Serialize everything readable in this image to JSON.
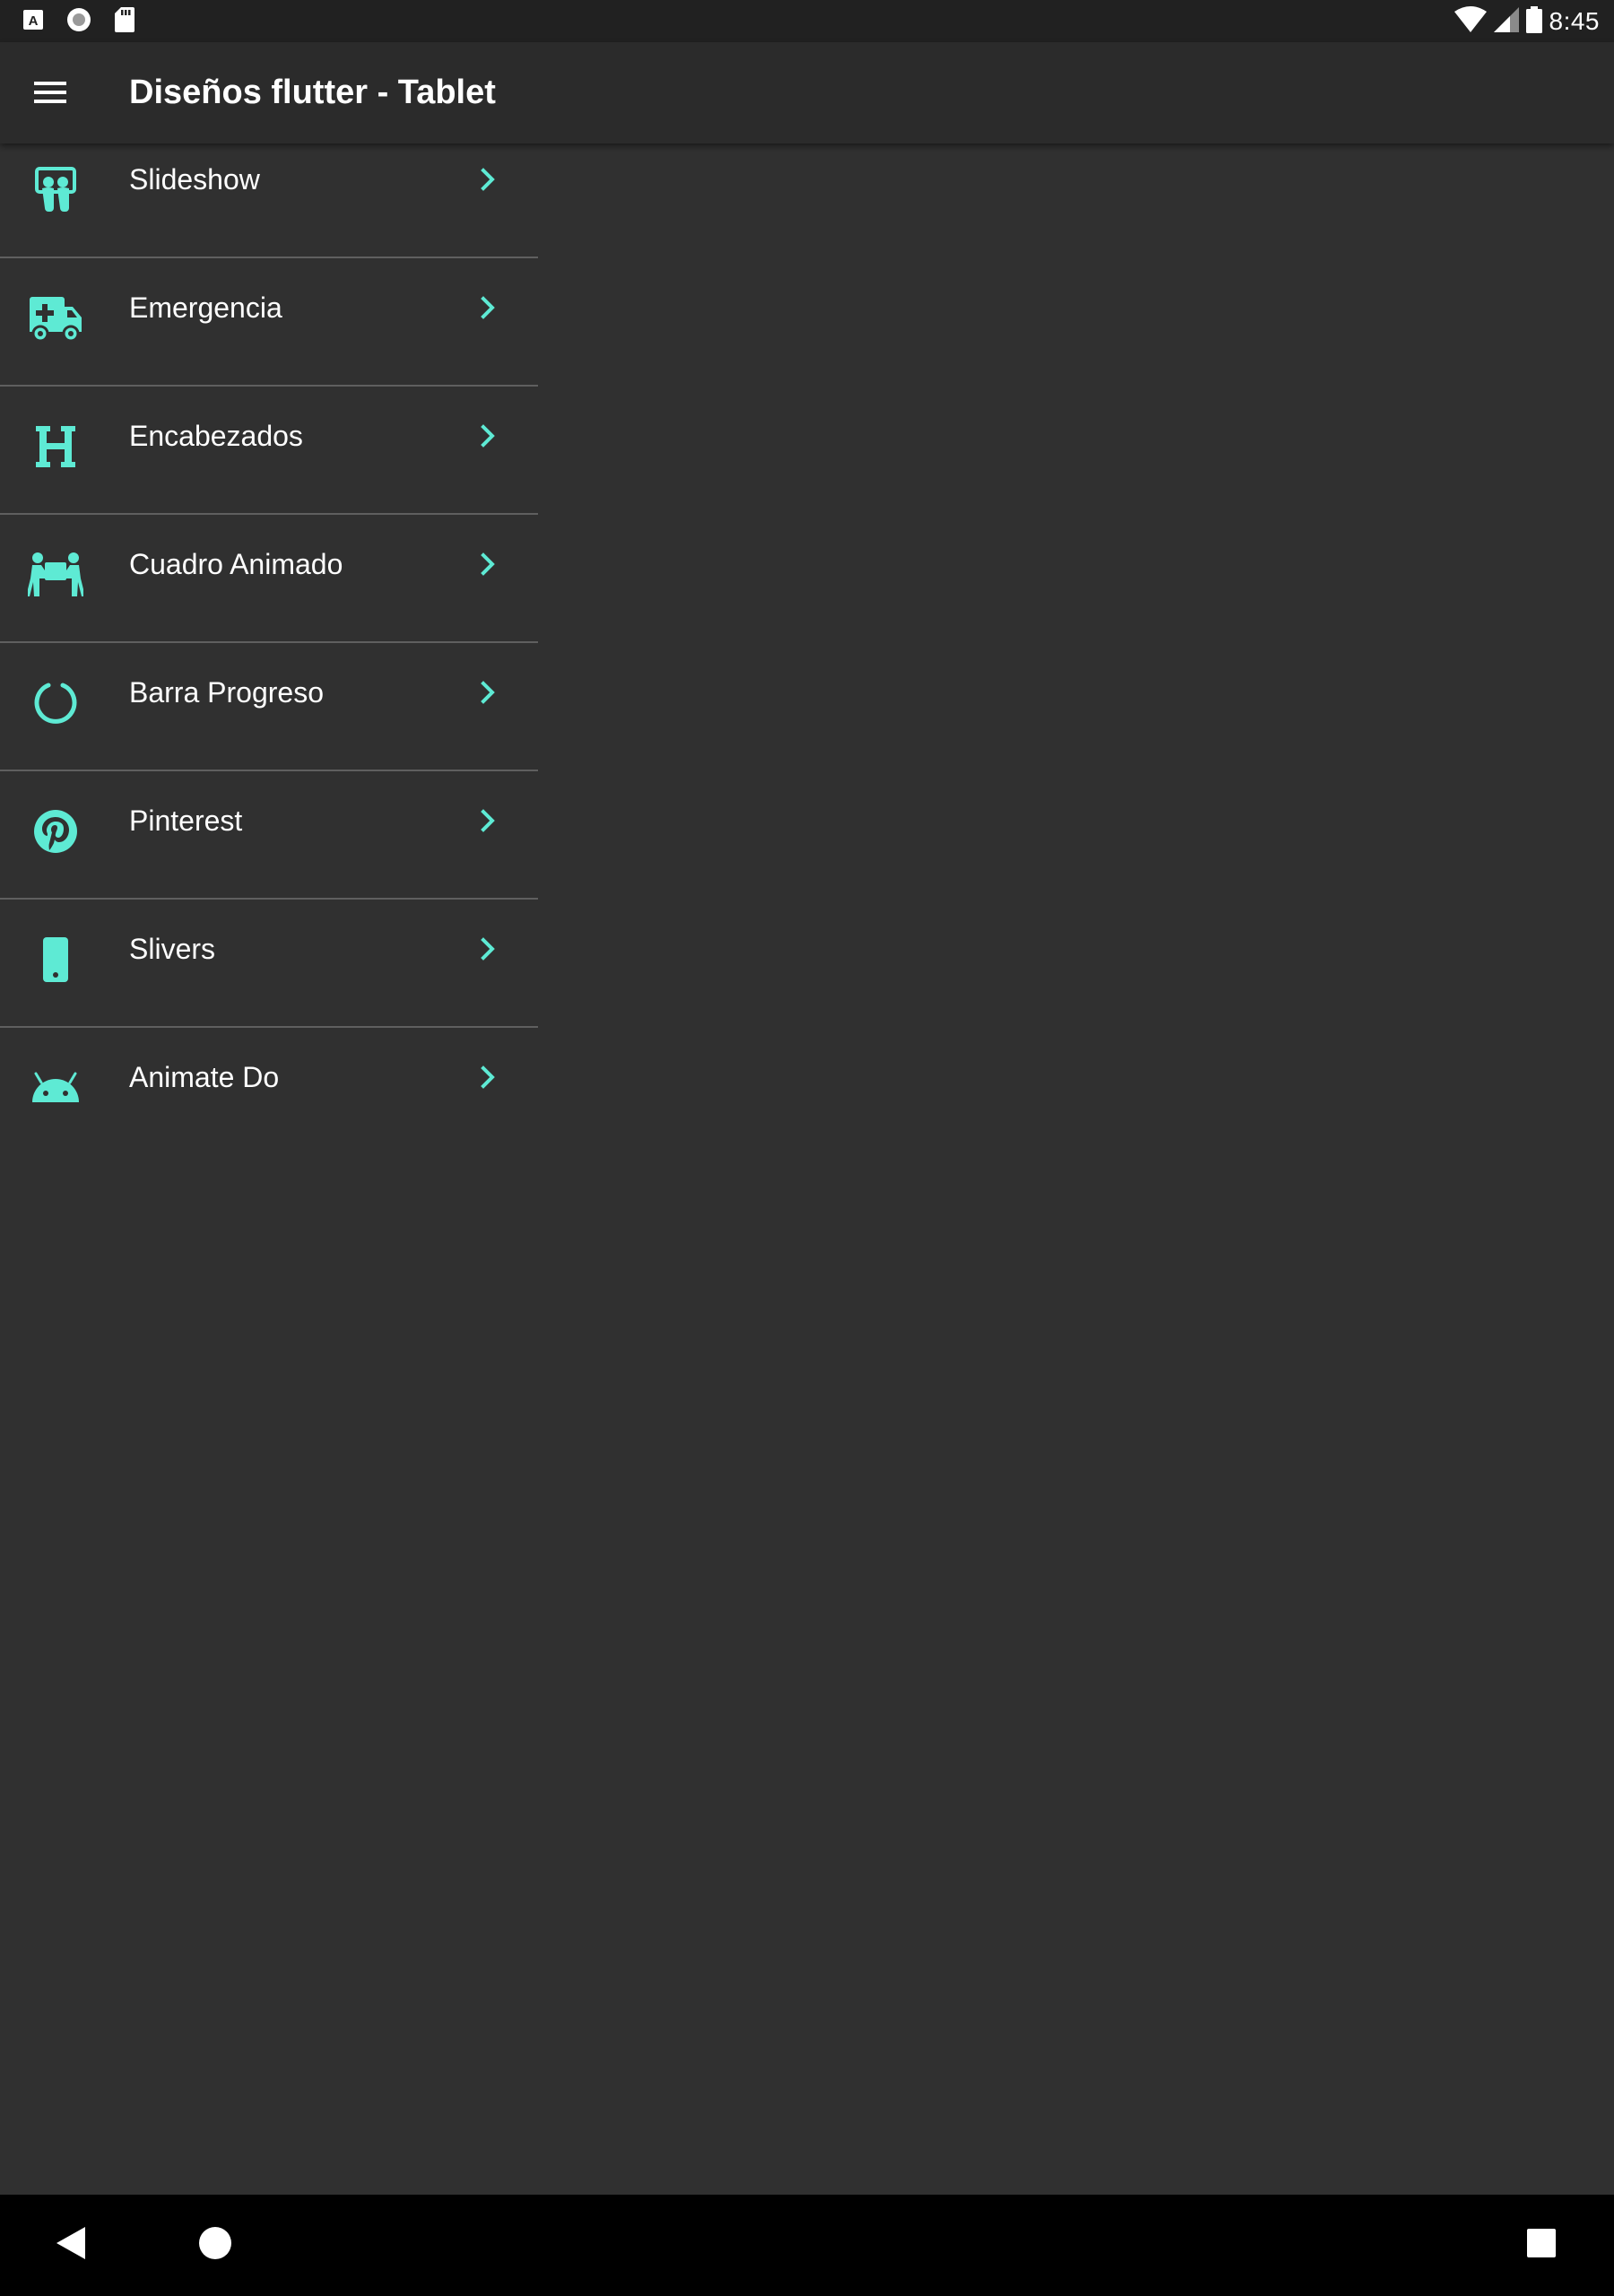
{
  "status_bar": {
    "time": "8:45",
    "left_icons": [
      "a-badge-icon",
      "record-icon",
      "sd-card-icon"
    ],
    "right_icons": [
      "wifi-icon",
      "cell-signal-icon",
      "battery-icon"
    ]
  },
  "app_bar": {
    "title": "Diseños flutter - Tablet",
    "menu_icon": "hamburger-menu-icon"
  },
  "colors": {
    "accent": "#5EEAD4",
    "background": "#303030",
    "app_bar": "#2b2b2b",
    "status_bar": "#212121",
    "nav_bar": "#000000",
    "divider": "#5f5f5f"
  },
  "menu": {
    "items": [
      {
        "label": "Slideshow",
        "icon": "slideshare-icon"
      },
      {
        "label": "Emergencia",
        "icon": "ambulance-icon"
      },
      {
        "label": "Encabezados",
        "icon": "heading-icon"
      },
      {
        "label": "Cuadro Animado",
        "icon": "people-carry-icon"
      },
      {
        "label": "Barra Progreso",
        "icon": "circle-notch-icon"
      },
      {
        "label": "Pinterest",
        "icon": "pinterest-icon"
      },
      {
        "label": "Slivers",
        "icon": "mobile-icon"
      },
      {
        "label": "Animate Do",
        "icon": "android-icon"
      }
    ]
  },
  "nav_bar": {
    "buttons": [
      "back-icon",
      "home-icon",
      "recents-icon"
    ]
  }
}
